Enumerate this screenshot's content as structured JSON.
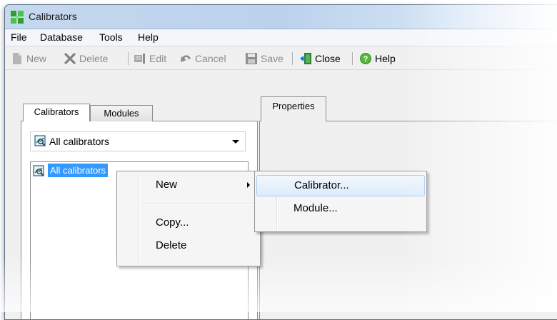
{
  "window": {
    "title": "Calibrators",
    "app_icon": "calibrators-app-icon"
  },
  "menubar": {
    "items": [
      {
        "label": "File"
      },
      {
        "label": "Database"
      },
      {
        "label": "Tools"
      },
      {
        "label": "Help"
      }
    ]
  },
  "toolbar": {
    "new_label": "New",
    "delete_label": "Delete",
    "edit_label": "Edit",
    "cancel_label": "Cancel",
    "save_label": "Save",
    "close_label": "Close",
    "help_label": "Help"
  },
  "left_tabs": [
    {
      "label": "Calibrators",
      "active": true
    },
    {
      "label": "Modules",
      "active": false
    }
  ],
  "filter_dropdown": {
    "selected": "All calibrators"
  },
  "tree": {
    "items": [
      {
        "label": "All calibrators",
        "selected": true
      }
    ]
  },
  "right_tabs": [
    {
      "label": "Properties",
      "active": true
    }
  ],
  "context_menu": {
    "items": [
      {
        "label": "New",
        "has_submenu": true
      },
      {
        "label": "Copy..."
      },
      {
        "label": "Delete"
      }
    ]
  },
  "submenu": {
    "items": [
      {
        "label": "Calibrator...",
        "highlighted": true
      },
      {
        "label": "Module..."
      }
    ]
  },
  "colors": {
    "selection": "#3399ff",
    "menu_highlight_border": "#a8cbf1"
  }
}
